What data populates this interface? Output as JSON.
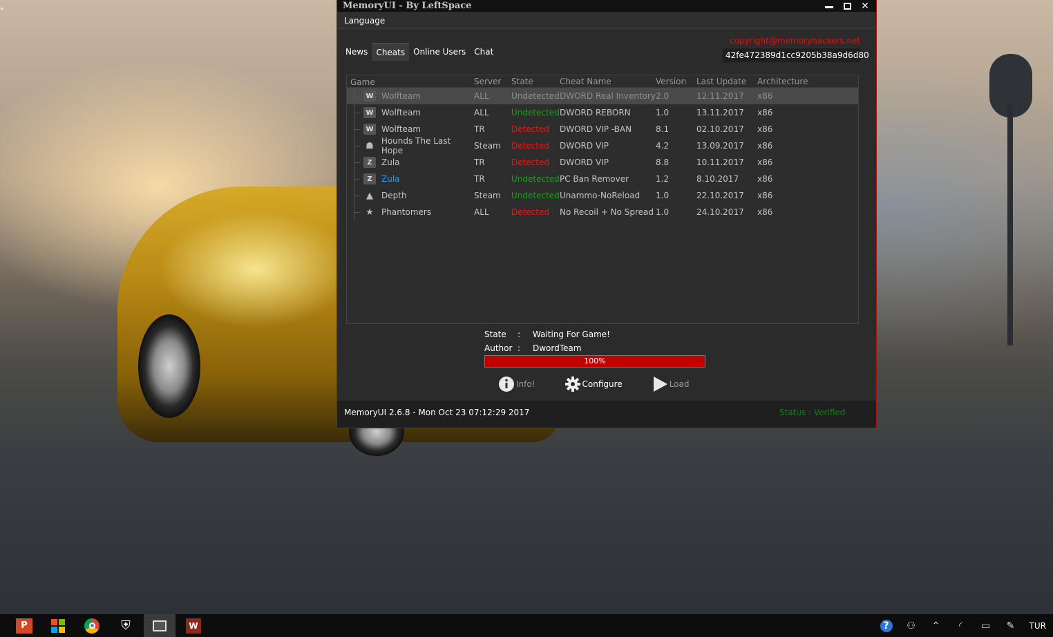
{
  "window": {
    "title": "MemoryUI - By LeftSpace",
    "menu": [
      "Language"
    ],
    "copyright": "copyright@memoryhackers.net",
    "hash": "42fe472389d1cc9205b38a9d6d80"
  },
  "tabs": [
    "News",
    "Cheats",
    "Online Users",
    "Chat"
  ],
  "table": {
    "headers": {
      "game": "Game",
      "server": "Server",
      "state": "State",
      "cheat": "Cheat Name",
      "version": "Version",
      "updated": "Last Update",
      "arch": "Architecture"
    },
    "rows": [
      {
        "game": "Wolfteam",
        "server": "ALL",
        "state": "Undetected",
        "cheat": "DWORD Real Inventory",
        "version": "2.0",
        "updated": "12.11.2017",
        "arch": "x86"
      },
      {
        "game": "Wolfteam",
        "server": "ALL",
        "state": "Undetected",
        "cheat": "DWORD REBORN",
        "version": "1.0",
        "updated": "13.11.2017",
        "arch": "x86"
      },
      {
        "game": "Wolfteam",
        "server": "TR",
        "state": "Detected",
        "cheat": "DWORD VIP -BAN",
        "version": "8.1",
        "updated": "02.10.2017",
        "arch": "x86"
      },
      {
        "game": "Hounds The Last Hope",
        "server": "Steam",
        "state": "Detected",
        "cheat": "DWORD VIP",
        "version": "4.2",
        "updated": "13.09.2017",
        "arch": "x86"
      },
      {
        "game": "Zula",
        "server": "TR",
        "state": "Detected",
        "cheat": "DWORD VIP",
        "version": "8.8",
        "updated": "10.11.2017",
        "arch": "x86"
      },
      {
        "game": "Zula",
        "server": "TR",
        "state": "Undetected",
        "cheat": "PC Ban Remover",
        "version": "1.2",
        "updated": "8.10.2017",
        "arch": "x86"
      },
      {
        "game": "Depth",
        "server": "Steam",
        "state": "Undetected",
        "cheat": "Unammo-NoReload",
        "version": "1.0",
        "updated": "22.10.2017",
        "arch": "x86"
      },
      {
        "game": "Phantomers",
        "server": "ALL",
        "state": "Detected",
        "cheat": "No Recoil + No Spread",
        "version": "1.0",
        "updated": "24.10.2017",
        "arch": "x86"
      }
    ]
  },
  "info": {
    "state_label": "State",
    "state_value": "Waiting For Game!",
    "author_label": "Author",
    "author_value": "DwordTeam",
    "colon": ":"
  },
  "progress": {
    "value": 1.0,
    "label": "100%"
  },
  "actions": {
    "info": "Info!",
    "configure": "Configure",
    "load": "Load"
  },
  "footer": {
    "left": "MemoryUI 2.6.8  -  Mon Oct 23 07:12:29 2017",
    "right": "Status : Verified"
  },
  "taskbar": {
    "language": "TUR"
  },
  "colors": {
    "detected": "#ee1515",
    "undetected": "#1f9f1f",
    "accent": "#c10000",
    "link": "#2a9df4"
  }
}
